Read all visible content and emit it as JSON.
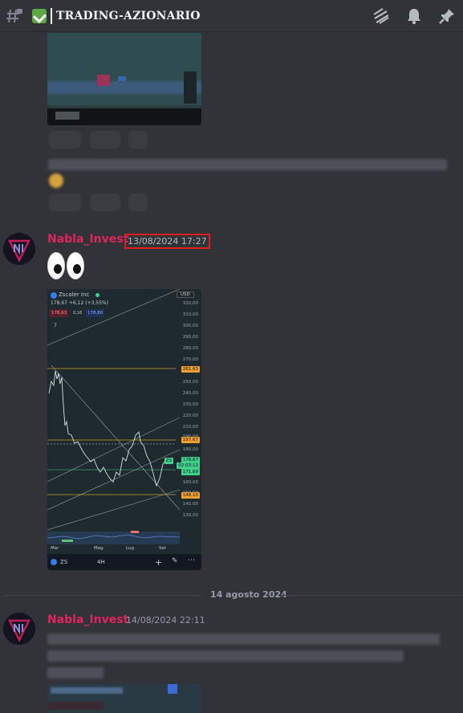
{
  "header": {
    "channel_name": "TRADING-AZIONARIO"
  },
  "messages": [
    {
      "username": "Nabla_Invest",
      "timestamp": "13/08/2024 17:27",
      "chart": {
        "ticker_name": "Zscaler Inc",
        "price_line": "178,67 +6,12 (+3,55%)",
        "sell_price": "178,63",
        "spread": "0,18",
        "buy_price": "178,80",
        "indicator_count": "7",
        "currency": "USD",
        "y_labels": [
          "320,00",
          "310,00",
          "300,00",
          "290,00",
          "280,00",
          "270,00",
          "250,00",
          "240,00",
          "230,00",
          "220,00",
          "210,00",
          "190,00",
          "180,00",
          "160,00",
          "150,00",
          "140,00",
          "130,00"
        ],
        "price_tags": [
          {
            "value": "261,63",
            "color": "#f0a030"
          },
          {
            "value": "197,67",
            "color": "#f0a030"
          },
          {
            "value": "178,67",
            "color": "#3fd08c"
          },
          {
            "value": "02:03:12",
            "color": "#3fd08c"
          },
          {
            "value": "171,69",
            "color": "#3fd08c"
          },
          {
            "value": "148,10",
            "color": "#f0a030"
          }
        ],
        "symbol_tag": "ZS",
        "x_labels": [
          "Mar",
          "Mag",
          "Lug",
          "Set"
        ],
        "bottom_symbol": "ZS",
        "bottom_interval": "4H"
      }
    },
    {
      "username": "Nabla_Invest",
      "timestamp": "14/08/2024 22:11"
    }
  ],
  "date_separator": "14 agosto 2024"
}
